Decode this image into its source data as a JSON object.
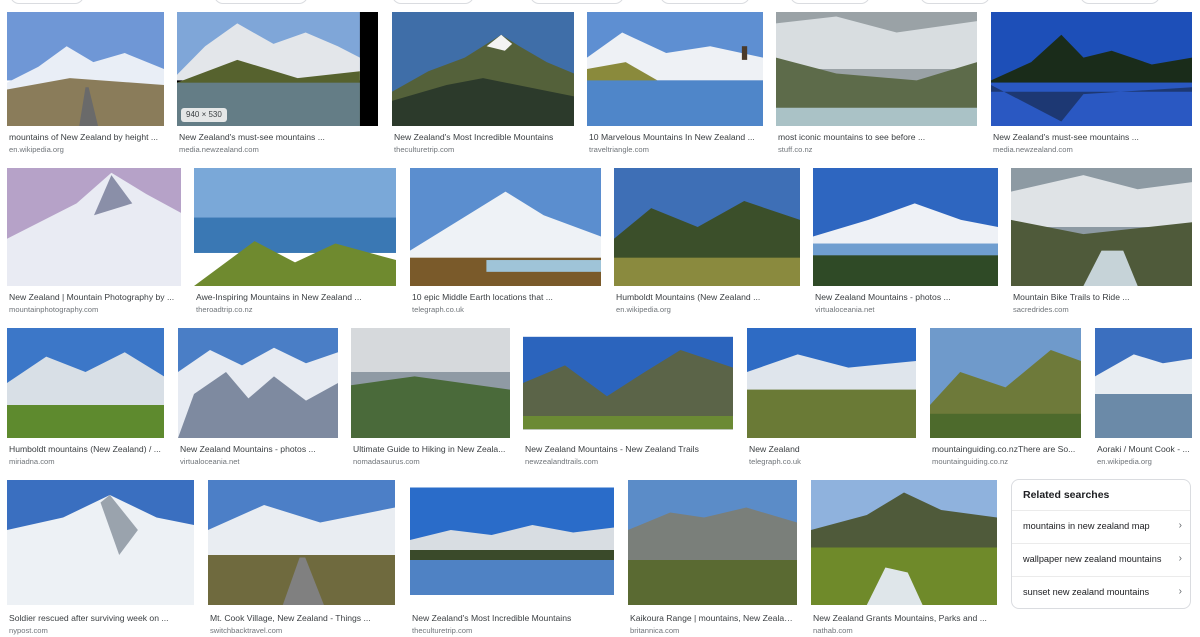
{
  "results": {
    "row1": [
      {
        "caption": "mountains of New Zealand by height ...",
        "source": "en.wikipedia.org"
      },
      {
        "caption": "New Zealand's must-see mountains ...",
        "source": "media.newzealand.com",
        "size_badge": "940 × 530"
      },
      {
        "caption": "New Zealand's Most Incredible Mountains",
        "source": "theculturetrip.com"
      },
      {
        "caption": "10 Marvelous Mountains In New Zealand ...",
        "source": "traveltriangle.com"
      },
      {
        "caption": "most iconic mountains to see before ...",
        "source": "stuff.co.nz"
      },
      {
        "caption": "New Zealand's must-see mountains ...",
        "source": "media.newzealand.com"
      }
    ],
    "row2": [
      {
        "caption": "New Zealand | Mountain Photography by ...",
        "source": "mountainphotography.com"
      },
      {
        "caption": "Awe-Inspiring Mountains in New Zealand ...",
        "source": "theroadtrip.co.nz"
      },
      {
        "caption": "10 epic Middle Earth locations that ...",
        "source": "telegraph.co.uk"
      },
      {
        "caption": "Humboldt Mountains (New Zealand ...",
        "source": "en.wikipedia.org"
      },
      {
        "caption": "New Zealand Mountains - photos ...",
        "source": "virtualoceania.net"
      },
      {
        "caption": "Mountain Bike Trails to Ride ...",
        "source": "sacredrides.com"
      }
    ],
    "row3": [
      {
        "caption": "Humboldt mountains (New Zealand) / ...",
        "source": "miriadna.com"
      },
      {
        "caption": "New Zealand Mountains - photos ...",
        "source": "virtualoceania.net"
      },
      {
        "caption": "Ultimate Guide to Hiking in New Zeala...",
        "source": "nomadasaurus.com"
      },
      {
        "caption": "New Zealand Mountains - New Zealand Trails",
        "source": "newzealandtrails.com"
      },
      {
        "caption": "New Zealand",
        "source": "telegraph.co.uk"
      },
      {
        "caption": "mountainguiding.co.nzThere are So...",
        "source": "mountainguiding.co.nz"
      },
      {
        "caption": "Aoraki / Mount Cook - ...",
        "source": "en.wikipedia.org"
      }
    ],
    "row4": [
      {
        "caption": "Soldier rescued after surviving week on ...",
        "source": "nypost.com"
      },
      {
        "caption": "Mt. Cook Village, New Zealand - Things ...",
        "source": "switchbacktravel.com"
      },
      {
        "caption": "New Zealand's Most Incredible Mountains",
        "source": "theculturetrip.com"
      },
      {
        "caption": "Kaikoura Range | mountains, New Zealand ...",
        "source": "britannica.com"
      },
      {
        "caption": "New Zealand Grants Mountains, Parks and ...",
        "source": "nathab.com"
      }
    ]
  },
  "related": {
    "title": "Related searches",
    "items": [
      {
        "label": "mountains in new zealand map"
      },
      {
        "label": "wallpaper new zealand mountains"
      },
      {
        "label": "sunset new zealand mountains"
      }
    ]
  },
  "icons": {
    "chevron": "chevron-right-icon"
  },
  "colors": {
    "link_text": "#3c4043",
    "source_text": "#70757a",
    "border": "#dadce0"
  }
}
